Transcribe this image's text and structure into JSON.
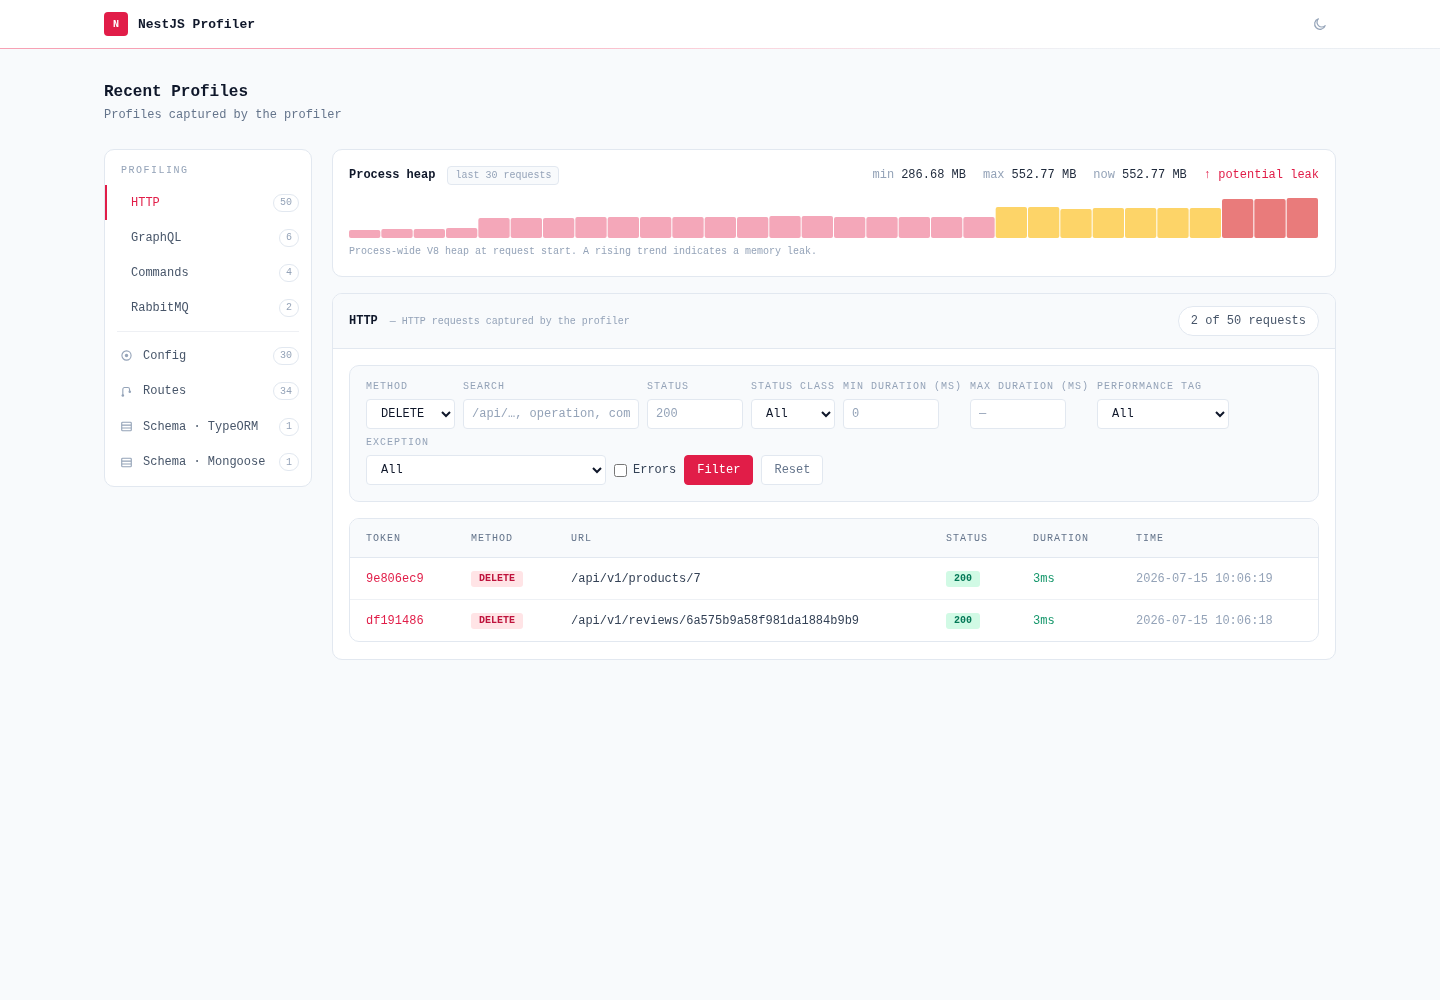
{
  "header": {
    "logo_letter": "N",
    "title": "NestJS Profiler"
  },
  "page": {
    "title": "Recent Profiles",
    "subtitle": "Profiles captured by the profiler"
  },
  "sidebar": {
    "section_label": "PROFILING",
    "items": [
      {
        "label": "HTTP",
        "count": "50",
        "selected": true
      },
      {
        "label": "GraphQL",
        "count": "6",
        "selected": false
      },
      {
        "label": "Commands",
        "count": "4",
        "selected": false
      },
      {
        "label": "RabbitMQ",
        "count": "2",
        "selected": false
      }
    ],
    "tools": [
      {
        "kind": "config",
        "label": "Config",
        "count": "30",
        "selected": false
      },
      {
        "kind": "route",
        "label": "Routes",
        "count": "34",
        "selected": false
      },
      {
        "kind": "schema",
        "label": "Schema · TypeORM",
        "count": "1",
        "selected": false
      },
      {
        "kind": "schema",
        "label": "Schema · Mongoose",
        "count": "1",
        "selected": false
      }
    ]
  },
  "heap": {
    "title": "Process heap",
    "badge": "last 30 requests",
    "stats": [
      {
        "label": "min",
        "value": "286.68 MB"
      },
      {
        "label": "max",
        "value": "552.77 MB"
      },
      {
        "label": "now",
        "value": "552.77 MB"
      }
    ],
    "alert": "↑ potential leak",
    "caption": "Process-wide V8 heap at request start. A rising trend indicates a memory leak."
  },
  "http": {
    "title": "HTTP",
    "subtitle": "— HTTP requests captured by the profiler",
    "count_pill": "2 of 50 requests",
    "filters": [
      {
        "kind": "select",
        "label": "METHOD",
        "value": "DELETE"
      },
      {
        "kind": "text",
        "label": "SEARCH",
        "placeholder": "/api/…, operation, com"
      },
      {
        "kind": "text",
        "label": "STATUS",
        "placeholder": "200"
      },
      {
        "kind": "select",
        "label": "STATUS CLASS",
        "value": "All"
      },
      {
        "kind": "text",
        "label": "MIN DURATION (MS)",
        "placeholder": "0"
      },
      {
        "kind": "text",
        "label": "MAX DURATION (MS)",
        "placeholder": "—"
      },
      {
        "kind": "select",
        "label": "PERFORMANCE TAG",
        "value": "All"
      },
      {
        "kind": "select",
        "label": "EXCEPTION",
        "value": "All"
      }
    ],
    "errors_checkbox": {
      "label": "Errors",
      "checked": false
    },
    "buttons": [
      {
        "kind": "primary",
        "label": "Filter"
      },
      {
        "kind": "secondary",
        "label": "Reset"
      }
    ],
    "table": {
      "columns": [
        "TOKEN",
        "METHOD",
        "URL",
        "STATUS",
        "DURATION",
        "TIME"
      ],
      "rows": [
        {
          "token": "9e806ec9",
          "method": "DELETE",
          "url": "/api/v1/products/7",
          "status": "200",
          "duration": "3ms",
          "time": "2026-07-15 10:06:19"
        },
        {
          "token": "df191486",
          "method": "DELETE",
          "url": "/api/v1/reviews/6a575b9a58f981da1884b9b9",
          "status": "200",
          "duration": "3ms",
          "time": "2026-07-15 10:06:18"
        }
      ]
    }
  }
}
